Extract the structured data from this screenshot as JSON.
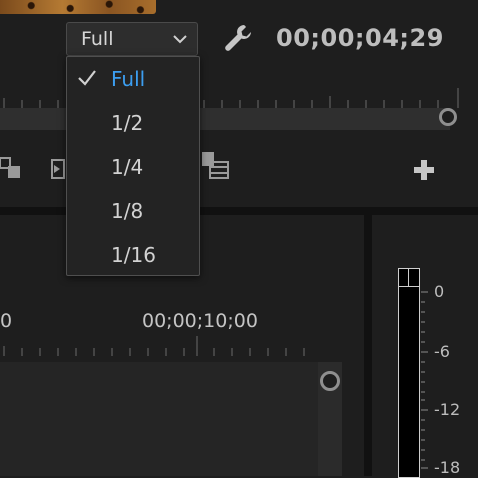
{
  "toolbar": {
    "resolution_value": "Full",
    "timecode": "00;00;04;29"
  },
  "resolution_menu": {
    "items": [
      {
        "label": "Full",
        "selected": true
      },
      {
        "label": "1/2",
        "selected": false
      },
      {
        "label": "1/4",
        "selected": false
      },
      {
        "label": "1/8",
        "selected": false
      },
      {
        "label": "1/16",
        "selected": false
      }
    ]
  },
  "timeline": {
    "ruler_labels": [
      "0",
      "00;00;10;00"
    ]
  },
  "audio_meter": {
    "scale_labels": [
      "0",
      "-6",
      "-12",
      "-18"
    ]
  },
  "colors": {
    "background": "#1e1e1e",
    "accent": "#3c9ef0",
    "text": "#d2d2d2"
  }
}
